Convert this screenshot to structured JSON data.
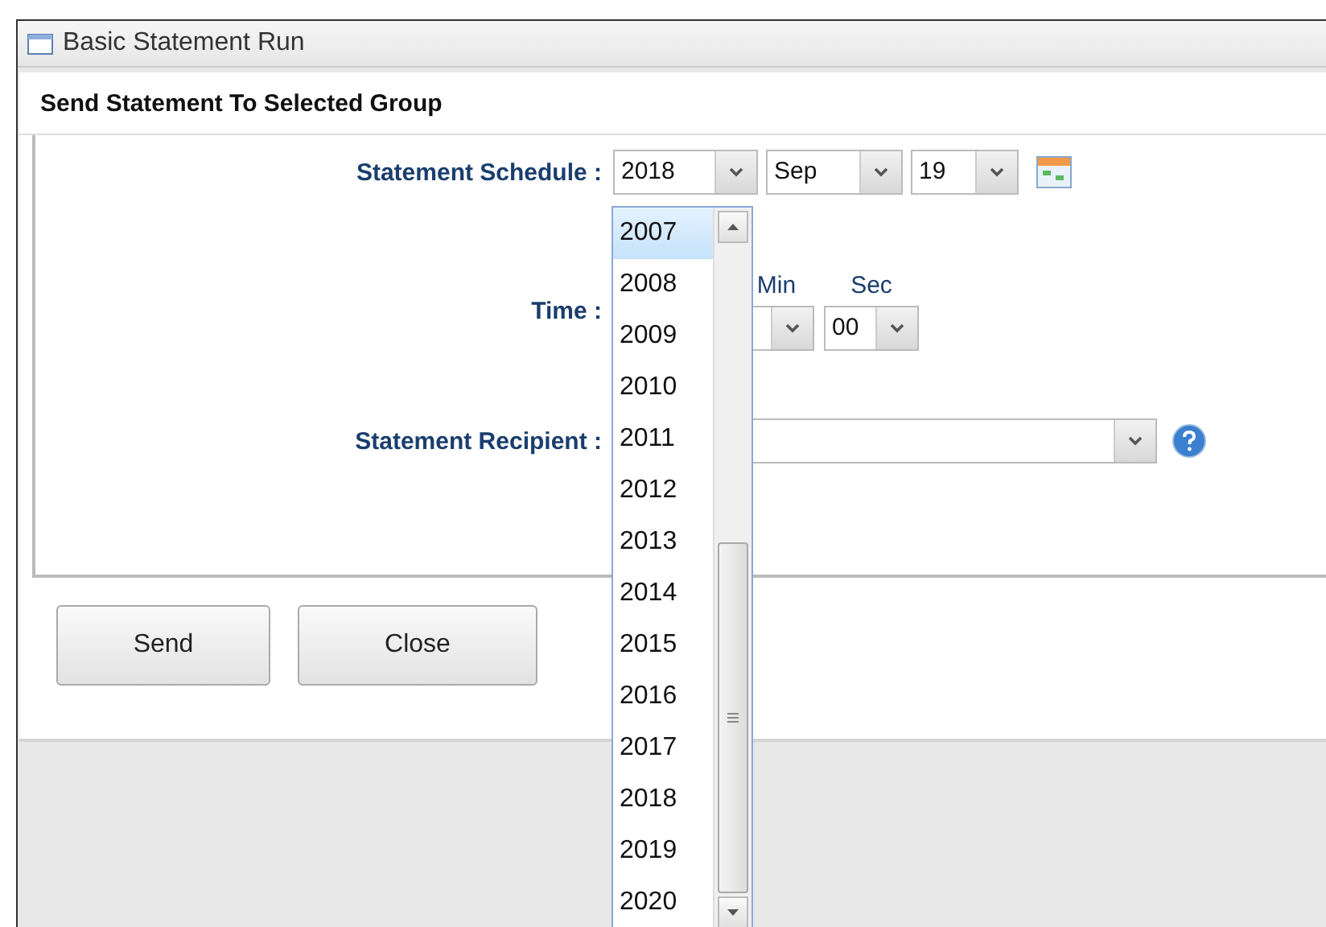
{
  "window": {
    "title": "Basic Statement Run"
  },
  "panel": {
    "title": "Send Statement To Selected Group"
  },
  "schedule": {
    "label": "Statement Schedule :",
    "year": "2018",
    "month": "Sep",
    "day": "19"
  },
  "time": {
    "label": "Time :",
    "minute": {
      "label": "Min"
    },
    "second": {
      "label": "Sec",
      "value": "00"
    }
  },
  "recipient": {
    "label": "Statement Recipient :"
  },
  "buttons": [
    "Send",
    "Close"
  ],
  "year_list": {
    "items": [
      {
        "label": "2007",
        "selected": true
      },
      {
        "label": "2008",
        "selected": false
      },
      {
        "label": "2009",
        "selected": false
      },
      {
        "label": "2010",
        "selected": false
      },
      {
        "label": "2011",
        "selected": false
      },
      {
        "label": "2012",
        "selected": false
      },
      {
        "label": "2013",
        "selected": false
      },
      {
        "label": "2014",
        "selected": false
      },
      {
        "label": "2015",
        "selected": false
      },
      {
        "label": "2016",
        "selected": false
      },
      {
        "label": "2017",
        "selected": false
      },
      {
        "label": "2018",
        "selected": false
      },
      {
        "label": "2019",
        "selected": false
      },
      {
        "label": "2020",
        "selected": false
      }
    ]
  }
}
